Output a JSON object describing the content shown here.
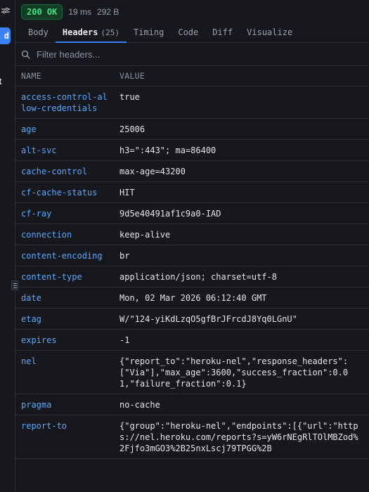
{
  "left_panel": {
    "button_label": "d",
    "partial_text": "t"
  },
  "status": {
    "code": "200 OK",
    "time": "19 ms",
    "size": "292 B"
  },
  "tabs": [
    {
      "label": "Body"
    },
    {
      "label": "Headers",
      "count": "(25)",
      "active": true
    },
    {
      "label": "Timing"
    },
    {
      "label": "Code"
    },
    {
      "label": "Diff"
    },
    {
      "label": "Visualize"
    }
  ],
  "filter": {
    "placeholder": "Filter headers..."
  },
  "columns": {
    "name": "NAME",
    "value": "VALUE"
  },
  "headers": [
    {
      "name": "access-control-allow-credentials",
      "value": "true"
    },
    {
      "name": "age",
      "value": "25006"
    },
    {
      "name": "alt-svc",
      "value": "h3=\":443\"; ma=86400"
    },
    {
      "name": "cache-control",
      "value": "max-age=43200"
    },
    {
      "name": "cf-cache-status",
      "value": "HIT"
    },
    {
      "name": "cf-ray",
      "value": "9d5e40491af1c9a0-IAD"
    },
    {
      "name": "connection",
      "value": "keep-alive"
    },
    {
      "name": "content-encoding",
      "value": "br"
    },
    {
      "name": "content-type",
      "value": "application/json; charset=utf-8"
    },
    {
      "name": "date",
      "value": "Mon, 02 Mar 2026 06:12:40 GMT"
    },
    {
      "name": "etag",
      "value": "W/\"124-yiKdLzqO5gfBrJFrcdJ8Yq0LGnU\""
    },
    {
      "name": "expires",
      "value": "-1"
    },
    {
      "name": "nel",
      "value": "{\"report_to\":\"heroku-nel\",\"response_headers\":[\"Via\"],\"max_age\":3600,\"success_fraction\":0.01,\"failure_fraction\":0.1}"
    },
    {
      "name": "pragma",
      "value": "no-cache"
    },
    {
      "name": "report-to",
      "value": "{\"group\":\"heroku-nel\",\"endpoints\":[{\"url\":\"https://nel.heroku.com/reports?s=yW6rNEgRlTOlMBZod%2Fjfo3mGO3%2B25nxLscj79TPGG%2B"
    }
  ],
  "colors": {
    "background": "#16181d",
    "accent": "#3b82f6",
    "header_name": "#60a5fa",
    "status_ok": "#4ade80"
  }
}
